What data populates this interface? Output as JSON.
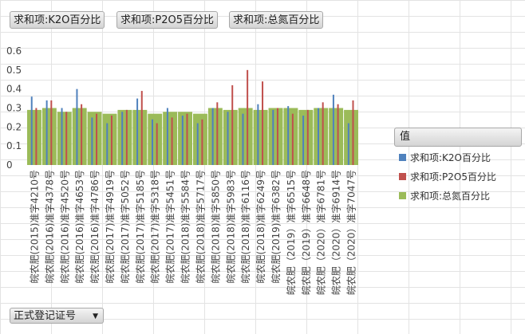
{
  "field_buttons": [
    "求和项:K2O百分比",
    "求和项:P2O5百分比",
    "求和项:总氮百分比"
  ],
  "legend": {
    "title": "值",
    "items": [
      {
        "label": "求和项:K2O百分比",
        "color": "#4f81bd"
      },
      {
        "label": "求和项:P2O5百分比",
        "color": "#c0504d"
      },
      {
        "label": "求和项:总氮百分比",
        "color": "#9bbb59"
      }
    ]
  },
  "filter": {
    "label": "正式登记证号",
    "icon": "dropdown-arrow-icon"
  },
  "chart_data": {
    "type": "bar",
    "title": "",
    "xlabel": "",
    "ylabel": "",
    "ylim": [
      0,
      0.6
    ],
    "yticks": [
      "0",
      "0.1",
      "0.2",
      "0.3",
      "0.4",
      "0.5",
      "0.6"
    ],
    "grid": false,
    "legend_position": "right",
    "categories": [
      "皖农肥(2015)准字4210号",
      "皖农肥(2016)准字4378号",
      "皖农肥(2016)准字4520号",
      "皖农肥(2016)准字4653号",
      "皖农肥(2016)准字4786号",
      "皖农肥(2017)准字4919号",
      "皖农肥(2017)准字5052号",
      "皖农肥(2017)准字5185号",
      "皖农肥(2017)准字5318号",
      "皖农肥(2017)准字5451号",
      "皖农肥(2018)准字5584号",
      "皖农肥(2018)准字5717号",
      "皖农肥(2018)准字5850号",
      "皖农肥(2018)准字5983号",
      "皖农肥(2018)准字6116号",
      "皖农肥(2018)准字6249号",
      "皖农肥(2019)准字6382号",
      "皖农肥（2019）准字6515号",
      "皖农肥（2019）准字6648号",
      "皖农肥（2020）准字6781号",
      "皖农肥（2020）准字6914号",
      "皖农肥（2020）准字7047号"
    ],
    "series": [
      {
        "name": "求和项:K2O百分比",
        "values": [
          0.36,
          0.34,
          0.3,
          0.4,
          0.25,
          0.22,
          0.28,
          0.35,
          0.24,
          0.3,
          0.26,
          0.22,
          0.3,
          0.28,
          0.27,
          0.32,
          0.29,
          0.31,
          0.26,
          0.3,
          0.37,
          0.22
        ]
      },
      {
        "name": "求和项:P2O5百分比",
        "values": [
          0.3,
          0.34,
          0.28,
          0.32,
          0.27,
          0.26,
          0.29,
          0.39,
          0.22,
          0.25,
          0.27,
          0.24,
          0.33,
          0.42,
          0.5,
          0.44,
          0.3,
          0.27,
          0.29,
          0.33,
          0.32,
          0.34
        ]
      },
      {
        "name": "求和项:总氮百分比",
        "values": [
          0.29,
          0.3,
          0.28,
          0.3,
          0.28,
          0.27,
          0.29,
          0.29,
          0.27,
          0.28,
          0.28,
          0.27,
          0.3,
          0.29,
          0.3,
          0.29,
          0.3,
          0.3,
          0.29,
          0.3,
          0.3,
          0.29
        ]
      }
    ]
  }
}
